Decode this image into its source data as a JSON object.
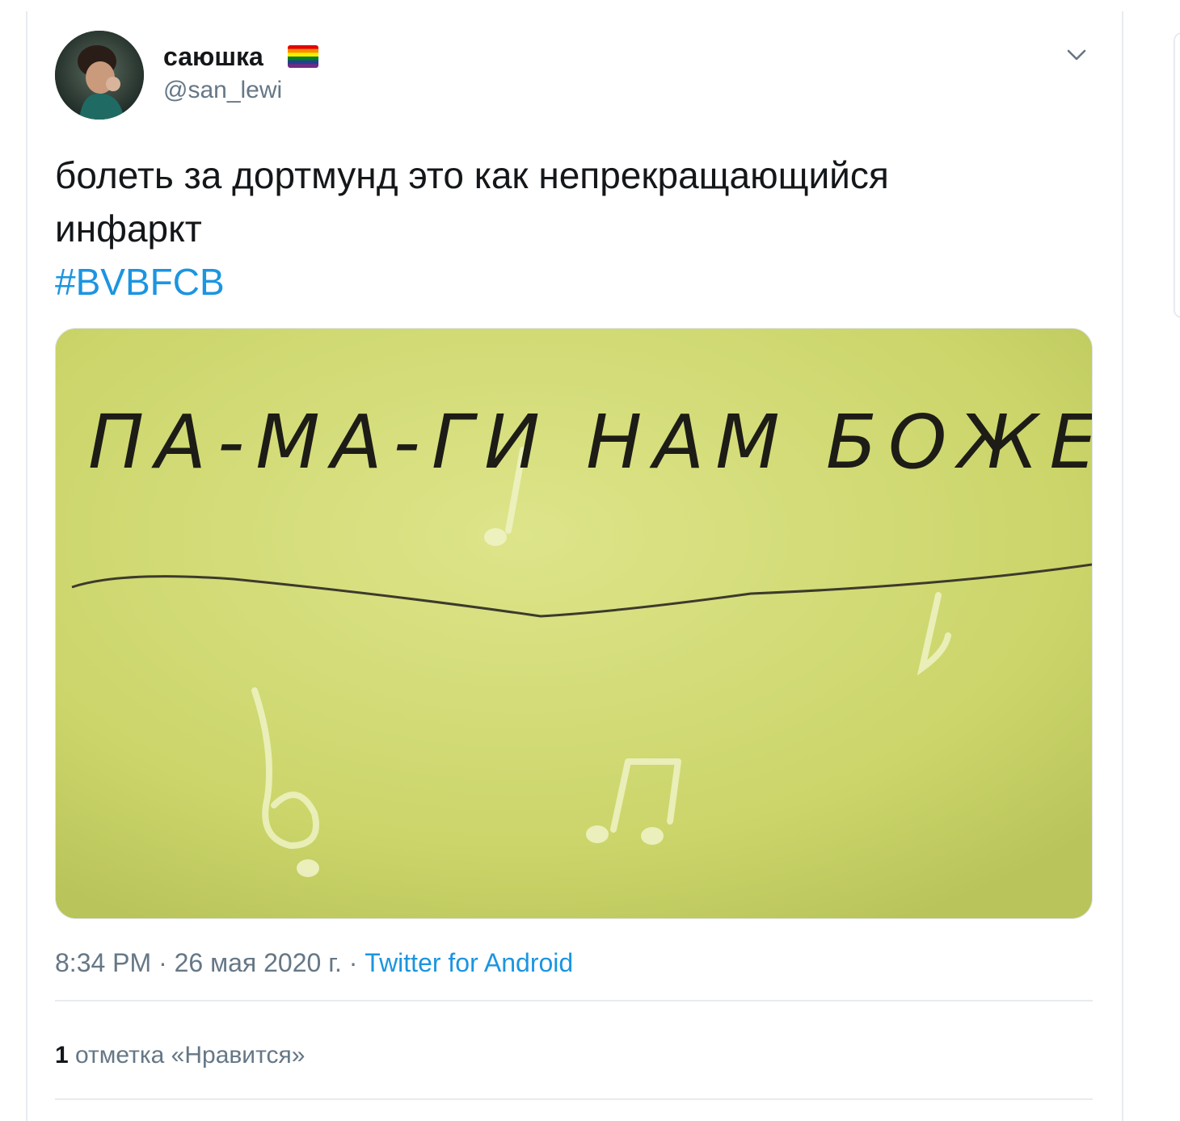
{
  "tweet": {
    "display_name": "саюшка",
    "flag_icon": "rainbow-flag-icon",
    "handle": "@san_lewi",
    "menu_icon": "chevron-down-icon",
    "text_line1": "болеть за дортмунд это как непрекращающийся",
    "text_line2": "инфаркт",
    "hashtag": "#BVBFCB",
    "media": {
      "handwriting": "ПА-МА-ГИ НАМ БОЖЕ",
      "background_color": "#cdd76b"
    },
    "time": "8:34 PM",
    "separator": "·",
    "date": "26 мая 2020 г.",
    "source": "Twitter for Android",
    "likes_count": "1",
    "likes_label": "отметка «Нравится»"
  },
  "colors": {
    "accent": "#1b95e0",
    "secondary_text": "#657786",
    "primary_text": "#14171a",
    "border": "#e6ecf0"
  }
}
